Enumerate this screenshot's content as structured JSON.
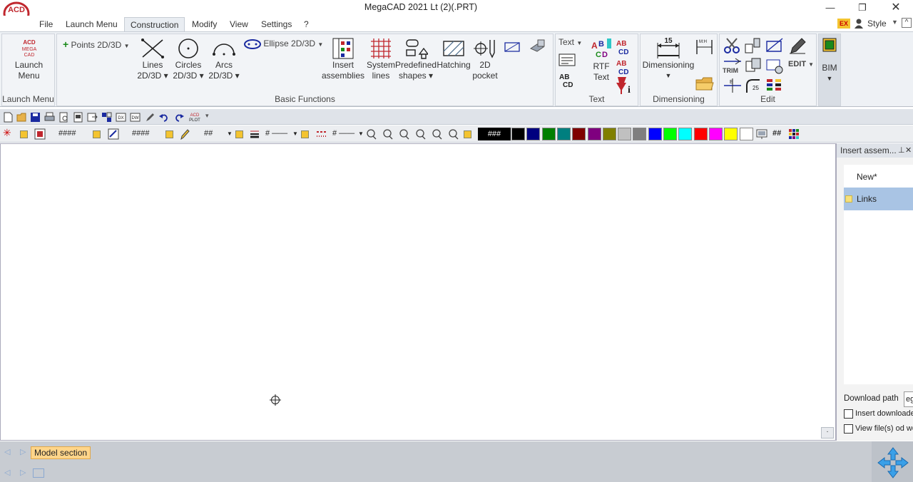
{
  "window": {
    "title": "MegaCAD 2021 Lt (2)(.PRT)",
    "style_label": "Style"
  },
  "menu": [
    "File",
    "Launch Menu",
    "Construction",
    "Modify",
    "View",
    "Settings",
    "?"
  ],
  "active_tab": "Construction",
  "ribbon": {
    "launch": {
      "label_line1": "Launch",
      "label_line2": "Menu",
      "group": "Launch Menu"
    },
    "basic": {
      "group": "Basic Functions",
      "points": "Points 2D/3D",
      "lines": [
        "Lines",
        "2D/3D"
      ],
      "circles": [
        "Circles",
        "2D/3D"
      ],
      "arcs": [
        "Arcs",
        "2D/3D"
      ],
      "ellipse": "Ellipse 2D/3D",
      "insert": [
        "Insert",
        "assemblies"
      ],
      "system": [
        "System",
        "lines"
      ],
      "predefined": [
        "Predefined",
        "shapes"
      ],
      "hatching": "Hatching",
      "pocket": [
        "2D",
        "pocket"
      ]
    },
    "text": {
      "group": "Text",
      "text_dropdown": "Text",
      "rtf": [
        "RTF",
        "Text"
      ]
    },
    "dimensioning": {
      "group": "Dimensioning",
      "label": "Dimensioning"
    },
    "edit": {
      "group": "Edit",
      "edit_label": "EDIT",
      "trim": "TRIM"
    },
    "bim": {
      "label": "BIM"
    }
  },
  "toolbar": {
    "hash4a": "####",
    "hash4b": "####",
    "hash2a": "##",
    "hash_line1": "# ——",
    "hash_line2": "# ——",
    "color_field": "###",
    "hash2b": "##"
  },
  "colors": [
    "#000000",
    "#00007f",
    "#007f00",
    "#007f7f",
    "#7f0000",
    "#7f007f",
    "#7f7f00",
    "#c0c0c0",
    "#7f7f7f",
    "#0000ff",
    "#00ff00",
    "#00ffff",
    "#ff0000",
    "#ff00ff",
    "#ffff00",
    "#ffffff"
  ],
  "panel": {
    "title": "Insert assem...",
    "items": [
      "New*",
      "Links"
    ],
    "download_label": "Download path",
    "download_value": "ega",
    "check1": "Insert downloade",
    "check2": "View file(s) od we"
  },
  "status": {
    "tab": "Model section"
  }
}
